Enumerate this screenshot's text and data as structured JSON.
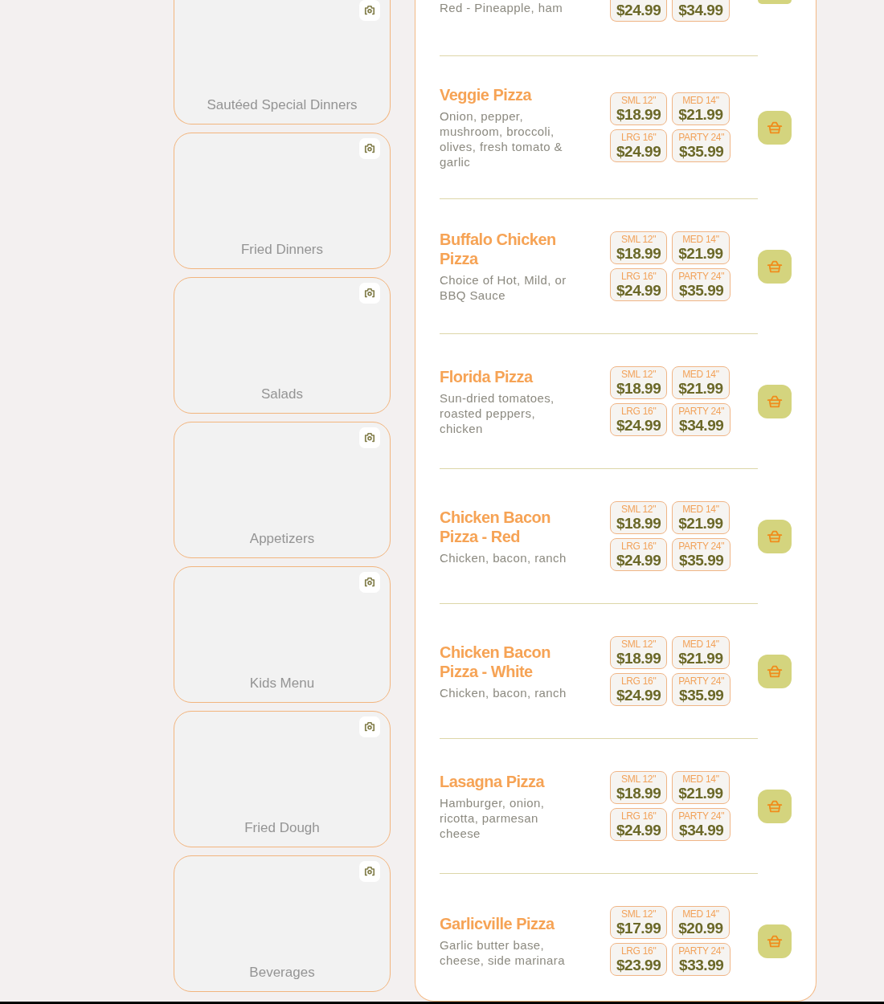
{
  "categories": [
    {
      "label": "Sautéed Special Dinners"
    },
    {
      "label": "Fried Dinners"
    },
    {
      "label": "Salads"
    },
    {
      "label": "Appetizers"
    },
    {
      "label": "Kids Menu"
    },
    {
      "label": "Fried Dough"
    },
    {
      "label": "Beverages"
    }
  ],
  "menu_items": [
    {
      "description": "Red - Pineapple, ham",
      "prices": [
        {
          "price": "$24.99"
        },
        {
          "price": "$34.99"
        }
      ]
    },
    {
      "name": "Veggie Pizza",
      "description": "Onion, pepper, mushroom, broccoli, olives, fresh tomato & garlic",
      "prices": [
        {
          "size": "SML 12\"",
          "price": "$18.99"
        },
        {
          "size": "MED 14\"",
          "price": "$21.99"
        },
        {
          "size": "LRG 16\"",
          "price": "$24.99"
        },
        {
          "size": "PARTY 24\"",
          "price": "$35.99"
        }
      ]
    },
    {
      "name": "Buffalo Chicken Pizza",
      "description": "Choice of Hot, Mild, or BBQ Sauce",
      "prices": [
        {
          "size": "SML 12\"",
          "price": "$18.99"
        },
        {
          "size": "MED 14\"",
          "price": "$21.99"
        },
        {
          "size": "LRG 16\"",
          "price": "$24.99"
        },
        {
          "size": "PARTY 24\"",
          "price": "$35.99"
        }
      ]
    },
    {
      "name": "Florida Pizza",
      "description": "Sun-dried tomatoes, roasted peppers, chicken",
      "prices": [
        {
          "size": "SML 12\"",
          "price": "$18.99"
        },
        {
          "size": "MED 14\"",
          "price": "$21.99"
        },
        {
          "size": "LRG 16\"",
          "price": "$24.99"
        },
        {
          "size": "PARTY 24\"",
          "price": "$34.99"
        }
      ]
    },
    {
      "name": "Chicken Bacon Pizza - Red",
      "description": "Chicken, bacon, ranch",
      "prices": [
        {
          "size": "SML 12\"",
          "price": "$18.99"
        },
        {
          "size": "MED 14\"",
          "price": "$21.99"
        },
        {
          "size": "LRG 16\"",
          "price": "$24.99"
        },
        {
          "size": "PARTY 24\"",
          "price": "$35.99"
        }
      ]
    },
    {
      "name": "Chicken Bacon Pizza - White",
      "description": "Chicken, bacon, ranch",
      "prices": [
        {
          "size": "SML 12\"",
          "price": "$18.99"
        },
        {
          "size": "MED 14\"",
          "price": "$21.99"
        },
        {
          "size": "LRG 16\"",
          "price": "$24.99"
        },
        {
          "size": "PARTY 24\"",
          "price": "$35.99"
        }
      ]
    },
    {
      "name": "Lasagna Pizza",
      "description": "Hamburger, onion, ricotta, parmesan cheese",
      "prices": [
        {
          "size": "SML 12\"",
          "price": "$18.99"
        },
        {
          "size": "MED 14\"",
          "price": "$21.99"
        },
        {
          "size": "LRG 16\"",
          "price": "$24.99"
        },
        {
          "size": "PARTY 24\"",
          "price": "$34.99"
        }
      ]
    },
    {
      "name": "Garlicville Pizza",
      "description": "Garlic butter base, cheese, side marinara",
      "prices": [
        {
          "size": "SML 12\"",
          "price": "$17.99"
        },
        {
          "size": "MED 14\"",
          "price": "$20.99"
        },
        {
          "size": "LRG 16\"",
          "price": "$23.99"
        },
        {
          "size": "PARTY 24\"",
          "price": "$33.99"
        }
      ]
    }
  ]
}
